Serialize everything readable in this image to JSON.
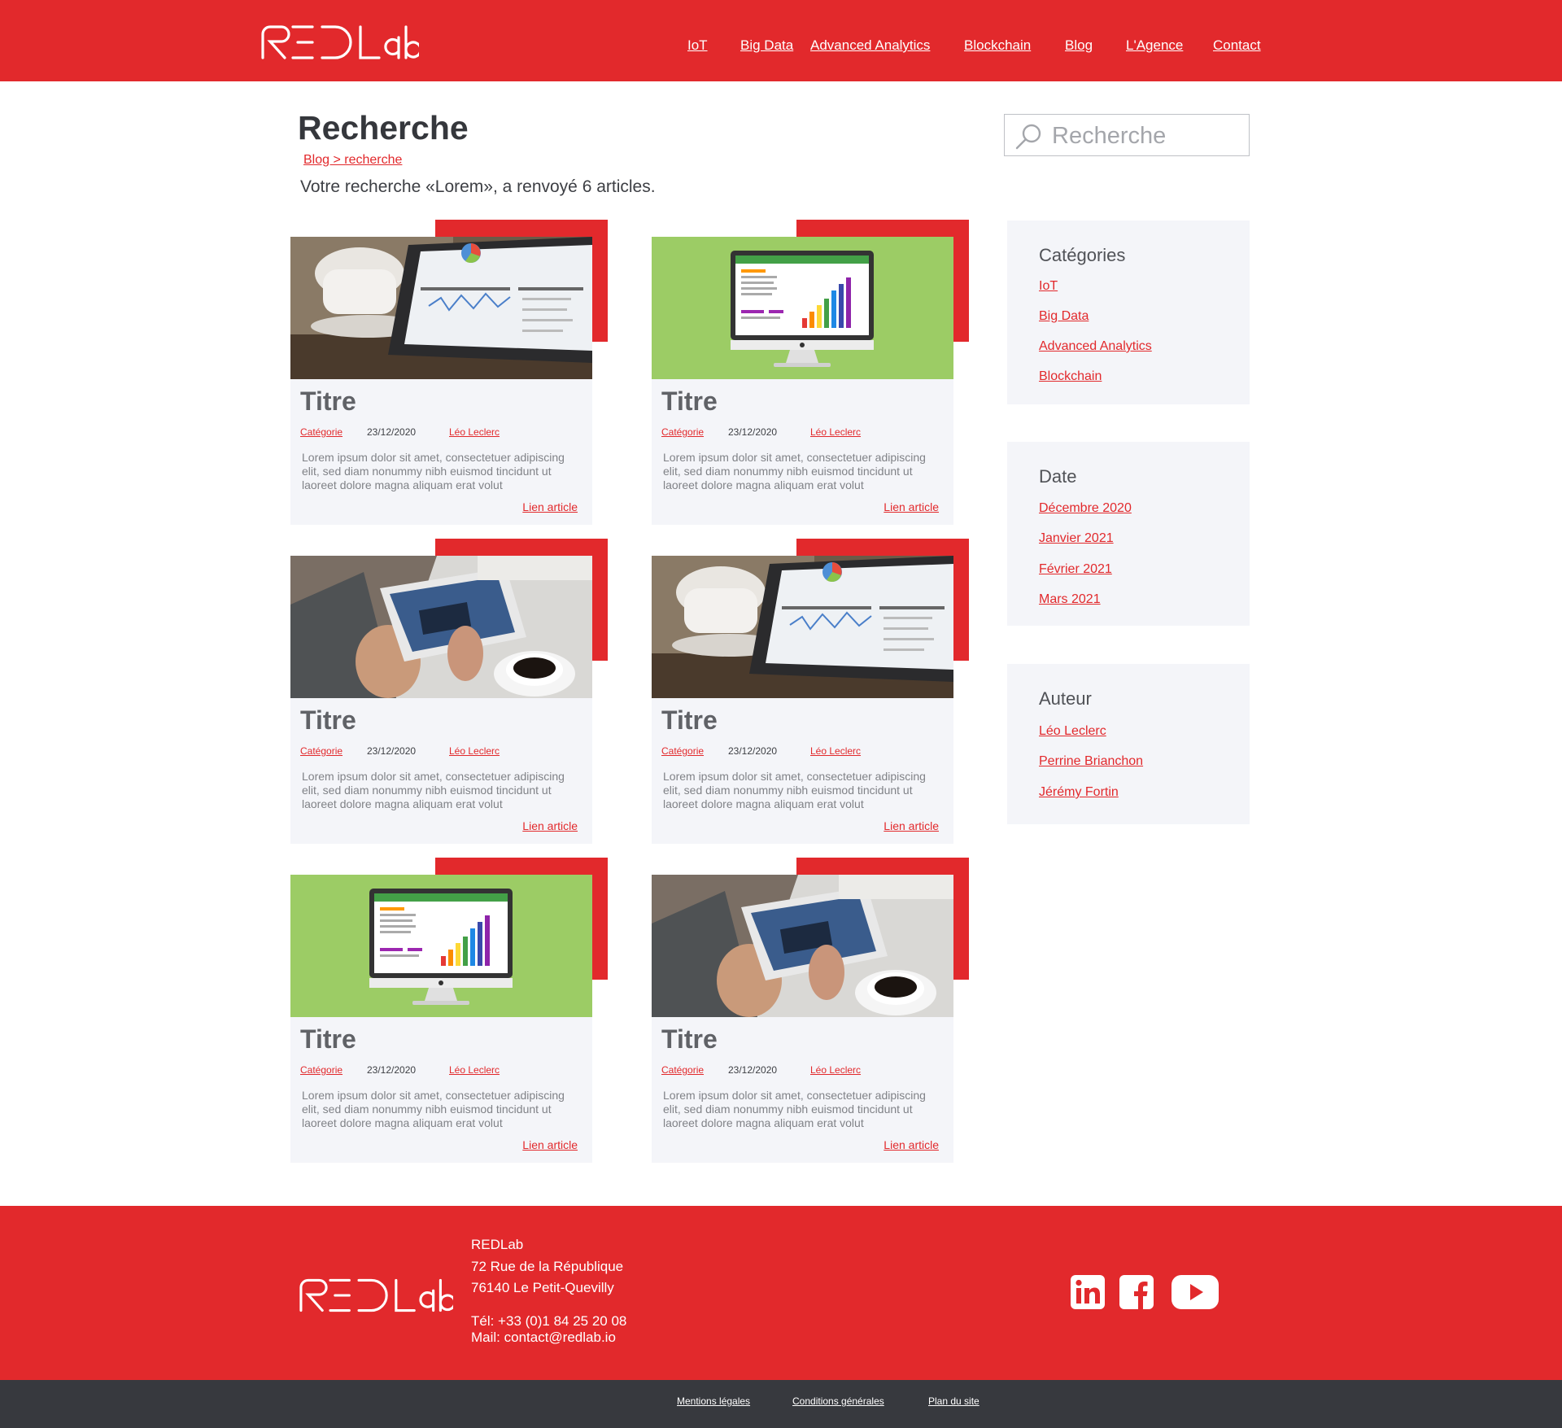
{
  "brand": {
    "logo_text": "RED Lab"
  },
  "nav": {
    "items": [
      "IoT",
      "Big Data",
      "Advanced Analytics",
      "Blockchain",
      "Blog",
      "L'Agence",
      "Contact"
    ]
  },
  "page": {
    "title": "Recherche",
    "breadcrumb": "Blog > recherche",
    "result_text": "Votre recherche «Lorem», a renvoyé 6 articles."
  },
  "search": {
    "placeholder": "Recherche"
  },
  "articles": [
    {
      "title": "Titre",
      "category": "Catégorie",
      "date": "23/12/2020",
      "author": "Léo Leclerc",
      "excerpt": "Lorem ipsum dolor sit amet, consectetuer adipiscing elit, sed diam nonummy nibh euismod tincidunt ut laoreet dolore magna aliquam erat volut",
      "link": "Lien article",
      "image": "tablet-analytics"
    },
    {
      "title": "Titre",
      "category": "Catégorie",
      "date": "23/12/2020",
      "author": "Léo Leclerc",
      "excerpt": "Lorem ipsum dolor sit amet, consectetuer adipiscing elit, sed diam nonummy nibh euismod tincidunt ut laoreet dolore magna aliquam erat volut",
      "link": "Lien article",
      "image": "monitor-dashboard"
    },
    {
      "title": "Titre",
      "category": "Catégorie",
      "date": "23/12/2020",
      "author": "Léo Leclerc",
      "excerpt": "Lorem ipsum dolor sit amet, consectetuer adipiscing elit, sed diam nonummy nibh euismod tincidunt ut laoreet dolore magna aliquam erat volut",
      "link": "Lien article",
      "image": "hands-tablet-coffee"
    },
    {
      "title": "Titre",
      "category": "Catégorie",
      "date": "23/12/2020",
      "author": "Léo Leclerc",
      "excerpt": "Lorem ipsum dolor sit amet, consectetuer adipiscing elit, sed diam nonummy nibh euismod tincidunt ut laoreet dolore magna aliquam erat volut",
      "link": "Lien article",
      "image": "tablet-analytics"
    },
    {
      "title": "Titre",
      "category": "Catégorie",
      "date": "23/12/2020",
      "author": "Léo Leclerc",
      "excerpt": "Lorem ipsum dolor sit amet, consectetuer adipiscing elit, sed diam nonummy nibh euismod tincidunt ut laoreet dolore magna aliquam erat volut",
      "link": "Lien article",
      "image": "monitor-dashboard"
    },
    {
      "title": "Titre",
      "category": "Catégorie",
      "date": "23/12/2020",
      "author": "Léo Leclerc",
      "excerpt": "Lorem ipsum dolor sit amet, consectetuer adipiscing elit, sed diam nonummy nibh euismod tincidunt ut laoreet dolore magna aliquam erat volut",
      "link": "Lien article",
      "image": "hands-tablet-coffee"
    }
  ],
  "sidebar": {
    "categories": {
      "heading": "Catégories",
      "items": [
        "IoT",
        "Big Data",
        "Advanced Analytics",
        "Blockchain"
      ]
    },
    "dates": {
      "heading": "Date",
      "items": [
        "Décembre 2020",
        "Janvier 2021",
        "Février 2021",
        "Mars 2021"
      ]
    },
    "authors": {
      "heading": "Auteur",
      "items": [
        "Léo Leclerc",
        "Perrine Brianchon",
        "Jérémy Fortin"
      ]
    }
  },
  "footer": {
    "company": "REDLab",
    "street": "72 Rue de la République",
    "city": "76140 Le Petit-Quevilly",
    "phone": "Tél: +33 (0)1 84 25 20 08",
    "mail": "Mail: contact@redlab.io",
    "social": [
      "linkedin-icon",
      "facebook-icon",
      "youtube-icon"
    ],
    "legal_links": [
      "Mentions légales",
      "Conditions générales",
      "Plan du site"
    ]
  },
  "colors": {
    "brand_red": "#e2292c",
    "dark_bar": "#37393e",
    "card_bg": "#f4f5f9",
    "green_bg": "#9ccc65"
  }
}
